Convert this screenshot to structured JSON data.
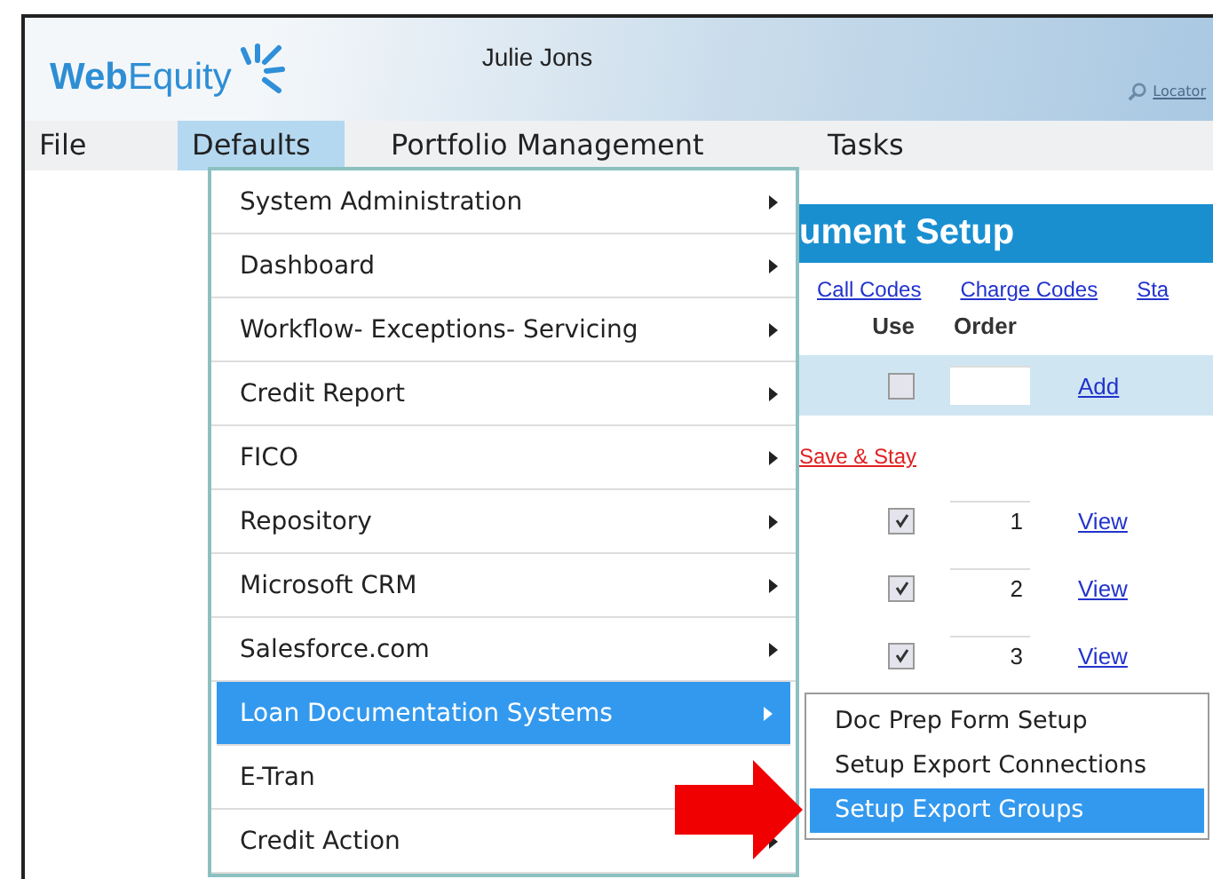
{
  "header": {
    "logo": "**Web**Equity",
    "user": "Julie Jons",
    "locator": "Locator"
  },
  "menubar": [
    {
      "label": "File",
      "selected": false
    },
    {
      "label": "Defaults",
      "selected": true
    },
    {
      "label": "Portfolio Management",
      "selected": false
    },
    {
      "label": "Tasks",
      "selected": false
    }
  ],
  "dropdown": [
    {
      "label": "System Administration",
      "submenu": true,
      "selected": false
    },
    {
      "label": "Dashboard",
      "submenu": true,
      "selected": false
    },
    {
      "label": "Workflow- Exceptions- Servicing",
      "submenu": true,
      "selected": false
    },
    {
      "label": "Credit Report",
      "submenu": true,
      "selected": false
    },
    {
      "label": "FICO",
      "submenu": true,
      "selected": false
    },
    {
      "label": "Repository",
      "submenu": true,
      "selected": false
    },
    {
      "label": "Microsoft CRM",
      "submenu": true,
      "selected": false
    },
    {
      "label": "Salesforce.com",
      "submenu": true,
      "selected": false
    },
    {
      "label": "Loan Documentation Systems",
      "submenu": true,
      "selected": true
    },
    {
      "label": "E-Tran",
      "submenu": false,
      "selected": false
    },
    {
      "label": "Credit Action",
      "submenu": true,
      "selected": false
    }
  ],
  "submenu": [
    {
      "label": "Doc Prep Form Setup",
      "selected": false
    },
    {
      "label": "Setup Export Connections",
      "selected": false
    },
    {
      "label": "Setup Export Groups",
      "selected": true
    }
  ],
  "page": {
    "title": "ument Setup",
    "links": [
      "Call Codes",
      "Charge Codes",
      "Sta"
    ],
    "columns": [
      "Use",
      "Order"
    ],
    "new_row": {
      "checked": false,
      "action": "Add"
    },
    "save_link": "Save & Stay",
    "rows": [
      {
        "checked": true,
        "order": "1",
        "action": "View"
      },
      {
        "checked": true,
        "order": "2",
        "action": "View"
      },
      {
        "checked": true,
        "order": "3",
        "action": "View"
      }
    ]
  }
}
